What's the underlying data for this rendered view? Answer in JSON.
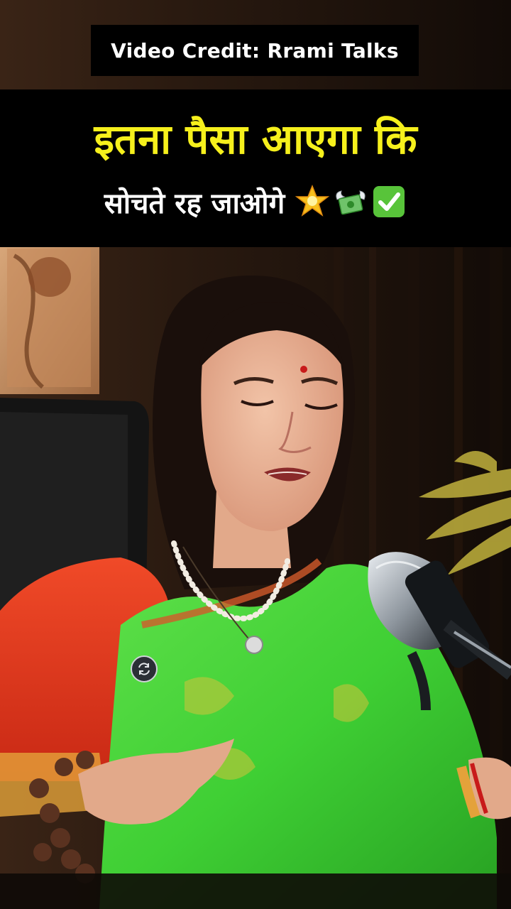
{
  "video_credit": "Video Credit: Rrami Talks",
  "caption": {
    "line1": "इतना पैसा आएगा कि",
    "line2": "सोचते रह जाओगे",
    "emojis": [
      "glowing-star-icon",
      "money-with-wings-icon",
      "check-mark-button-icon"
    ]
  },
  "colors": {
    "caption_highlight": "#f6f01c",
    "saree_green": "#3fcf34",
    "blouse_red": "#e2391f",
    "panel_black": "#000000"
  }
}
